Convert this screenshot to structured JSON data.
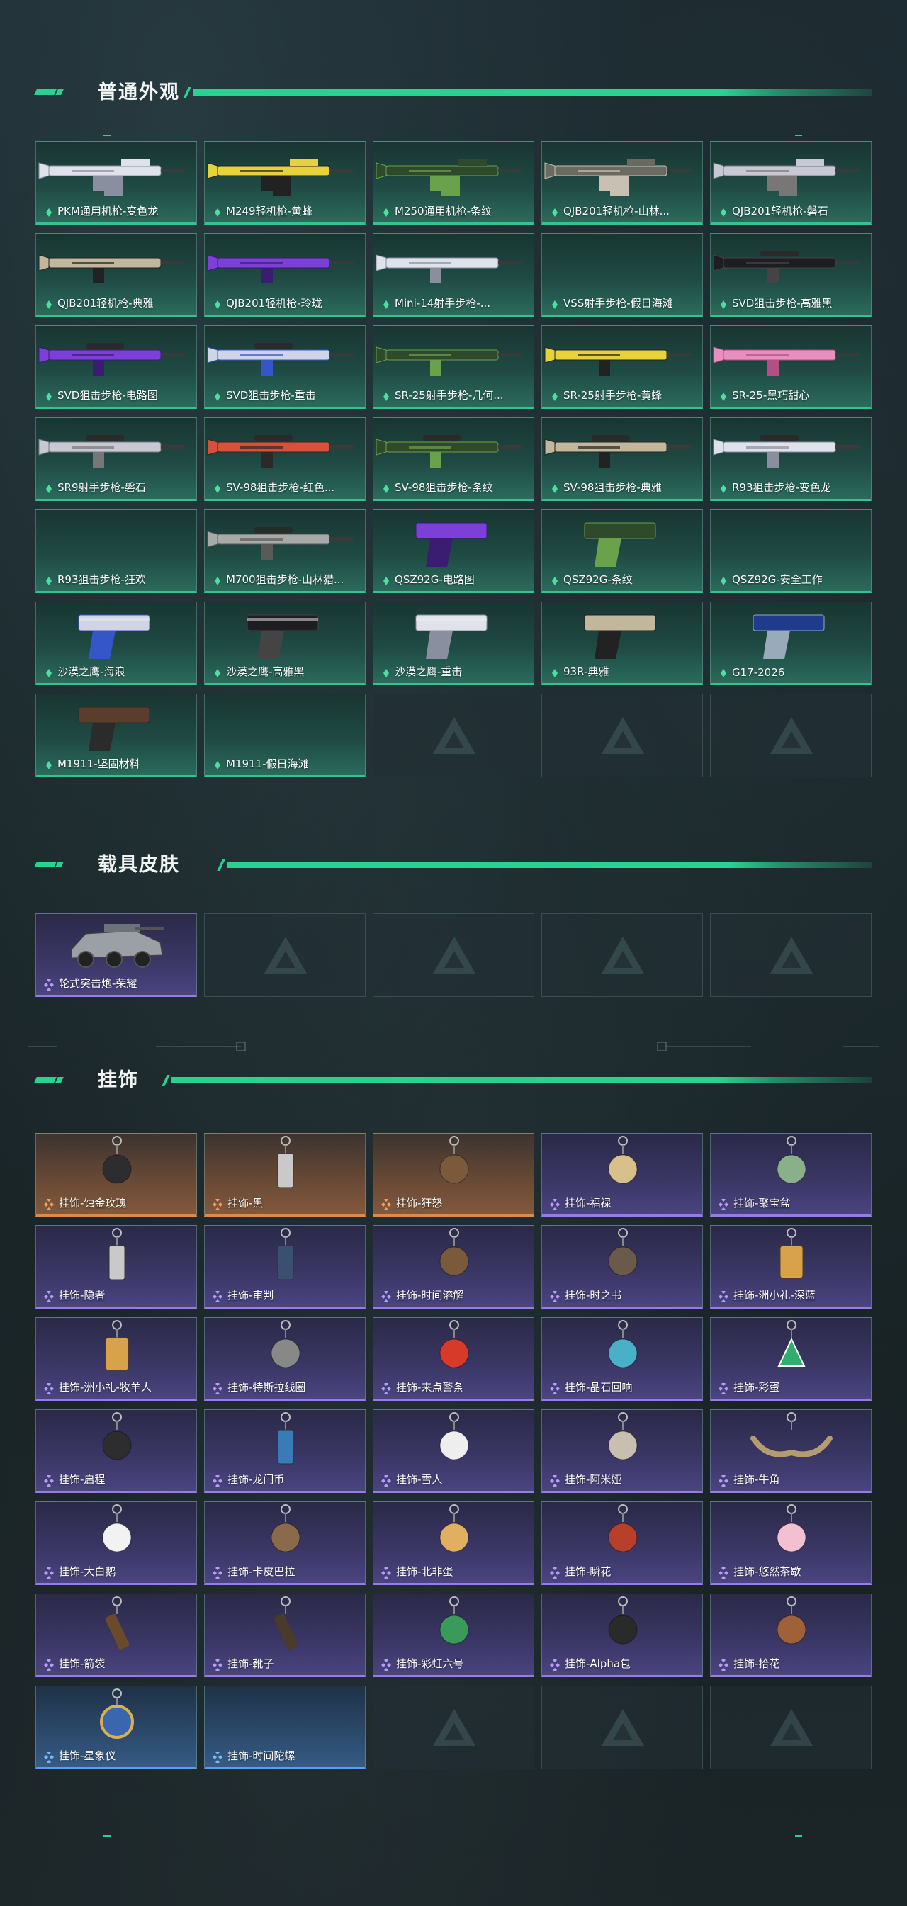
{
  "sections": {
    "weapons": {
      "title": "普通外观"
    },
    "vehicles": {
      "title": "载具皮肤"
    },
    "charms": {
      "title": "挂饰"
    }
  },
  "colors": {
    "accent": "#2bd18f",
    "green_rarity": "#33c48c",
    "purple_rarity": "#9a7ae6",
    "orange_rarity": "#e08a4a",
    "blue_rarity": "#5c9ee6"
  },
  "weapons": [
    {
      "label": "PKM通用机枪-变色龙",
      "rarity": "green",
      "art": "mg-white"
    },
    {
      "label": "M249轻机枪-黄蜂",
      "rarity": "green",
      "art": "mg-yellow"
    },
    {
      "label": "M250通用机枪-条纹",
      "rarity": "green",
      "art": "mg-green"
    },
    {
      "label": "QJB201轻机枪-山林...",
      "rarity": "green",
      "art": "mg-camo"
    },
    {
      "label": "QJB201轻机枪-磐石",
      "rarity": "green",
      "art": "mg-stone"
    },
    {
      "label": "QJB201轻机枪-典雅",
      "rarity": "green",
      "art": "rifle-tan"
    },
    {
      "label": "QJB201轻机枪-玲珑",
      "rarity": "green",
      "art": "rifle-purple"
    },
    {
      "label": "Mini-14射手步枪-...",
      "rarity": "green",
      "art": "rifle-white"
    },
    {
      "label": "VSS射手步枪-假日海滩",
      "rarity": "green",
      "art": "none"
    },
    {
      "label": "SVD狙击步枪-高雅黑",
      "rarity": "green",
      "art": "sniper-black"
    },
    {
      "label": "SVD狙击步枪-电路图",
      "rarity": "green",
      "art": "sniper-purple"
    },
    {
      "label": "SVD狙击步枪-重击",
      "rarity": "green",
      "art": "sniper-blue"
    },
    {
      "label": "SR-25射手步枪-几何...",
      "rarity": "green",
      "art": "rifle-green"
    },
    {
      "label": "SR-25射手步枪-黄蜂",
      "rarity": "green",
      "art": "rifle-yellow"
    },
    {
      "label": "SR-25-黑巧甜心",
      "rarity": "green",
      "art": "rifle-pink"
    },
    {
      "label": "SR9射手步枪-磐石",
      "rarity": "green",
      "art": "sniper-stone"
    },
    {
      "label": "SV-98狙击步枪-红色...",
      "rarity": "green",
      "art": "sniper-red"
    },
    {
      "label": "SV-98狙击步枪-条纹",
      "rarity": "green",
      "art": "sniper-green"
    },
    {
      "label": "SV-98狙击步枪-典雅",
      "rarity": "green",
      "art": "sniper-tan"
    },
    {
      "label": "R93狙击步枪-变色龙",
      "rarity": "green",
      "art": "sniper-white"
    },
    {
      "label": "R93狙击步枪-狂欢",
      "rarity": "green",
      "art": "none"
    },
    {
      "label": "M700狙击步枪-山林猎...",
      "rarity": "green",
      "art": "sniper-grey"
    },
    {
      "label": "QSZ92G-电路图",
      "rarity": "green",
      "art": "pistol-purple"
    },
    {
      "label": "QSZ92G-条纹",
      "rarity": "green",
      "art": "pistol-green"
    },
    {
      "label": "QSZ92G-安全工作",
      "rarity": "green",
      "art": "none"
    },
    {
      "label": "沙漠之鹰-海浪",
      "rarity": "green",
      "art": "eagle-blue"
    },
    {
      "label": "沙漠之鹰-高雅黑",
      "rarity": "green",
      "art": "eagle-black"
    },
    {
      "label": "沙漠之鹰-重击",
      "rarity": "green",
      "art": "eagle-white"
    },
    {
      "label": "93R-典雅",
      "rarity": "green",
      "art": "pistol-tan"
    },
    {
      "label": "G17-2026",
      "rarity": "green",
      "art": "pistol-navy"
    },
    {
      "label": "M1911-坚固材料",
      "rarity": "green",
      "art": "pistol-brown"
    },
    {
      "label": "M1911-假日海滩",
      "rarity": "green",
      "art": "none"
    }
  ],
  "vehicles": [
    {
      "label": "轮式突击炮-荣耀",
      "rarity": "purple",
      "art": "vehicle"
    }
  ],
  "charms": [
    {
      "label": "挂饰-蚀金玫瑰",
      "rarity": "orange",
      "art": "charm-dark"
    },
    {
      "label": "挂饰-黑",
      "rarity": "orange",
      "art": "charm-tag"
    },
    {
      "label": "挂饰-狂怒",
      "rarity": "orange",
      "art": "charm-small"
    },
    {
      "label": "挂饰-福禄",
      "rarity": "purple",
      "art": "charm-gourd"
    },
    {
      "label": "挂饰-聚宝盆",
      "rarity": "purple",
      "art": "charm-bowl"
    },
    {
      "label": "挂饰-隐者",
      "rarity": "purple",
      "art": "charm-tag"
    },
    {
      "label": "挂饰-审判",
      "rarity": "purple",
      "art": "charm-tag2"
    },
    {
      "label": "挂饰-时间溶解",
      "rarity": "purple",
      "art": "charm-small"
    },
    {
      "label": "挂饰-时之书",
      "rarity": "purple",
      "art": "charm-book"
    },
    {
      "label": "挂饰-洲小礼-深蓝",
      "rarity": "purple",
      "art": "charm-jar"
    },
    {
      "label": "挂饰-洲小礼-牧羊人",
      "rarity": "purple",
      "art": "charm-jar"
    },
    {
      "label": "挂饰-特斯拉线圈",
      "rarity": "purple",
      "art": "charm-coil"
    },
    {
      "label": "挂饰-来点警条",
      "rarity": "purple",
      "art": "charm-red"
    },
    {
      "label": "挂饰-晶石回响",
      "rarity": "purple",
      "art": "charm-ring"
    },
    {
      "label": "挂饰-彩蛋",
      "rarity": "purple",
      "art": "charm-tri"
    },
    {
      "label": "挂饰-启程",
      "rarity": "purple",
      "art": "charm-dark"
    },
    {
      "label": "挂饰-龙门币",
      "rarity": "purple",
      "art": "charm-coin"
    },
    {
      "label": "挂饰-雪人",
      "rarity": "purple",
      "art": "charm-snow"
    },
    {
      "label": "挂饰-阿米娅",
      "rarity": "purple",
      "art": "charm-bunny"
    },
    {
      "label": "挂饰-牛角",
      "rarity": "purple",
      "art": "charm-horn"
    },
    {
      "label": "挂饰-大白鹅",
      "rarity": "purple",
      "art": "charm-goose"
    },
    {
      "label": "挂饰-卡皮巴拉",
      "rarity": "purple",
      "art": "charm-capy"
    },
    {
      "label": "挂饰-北非蛋",
      "rarity": "purple",
      "art": "charm-egg"
    },
    {
      "label": "挂饰-瞬花",
      "rarity": "purple",
      "art": "charm-flower"
    },
    {
      "label": "挂饰-悠然茶歇",
      "rarity": "purple",
      "art": "charm-cake"
    },
    {
      "label": "挂饰-箭袋",
      "rarity": "purple",
      "art": "charm-quiver"
    },
    {
      "label": "挂饰-靴子",
      "rarity": "purple",
      "art": "charm-boot"
    },
    {
      "label": "挂饰-彩虹六号",
      "rarity": "purple",
      "art": "charm-r6"
    },
    {
      "label": "挂饰-Alpha包",
      "rarity": "purple",
      "art": "charm-bag"
    },
    {
      "label": "挂饰-拾花",
      "rarity": "purple",
      "art": "charm-frame"
    },
    {
      "label": "挂饰-星象仪",
      "rarity": "blue",
      "art": "charm-globe"
    },
    {
      "label": "挂饰-时间陀螺",
      "rarity": "blue",
      "art": "none"
    }
  ]
}
